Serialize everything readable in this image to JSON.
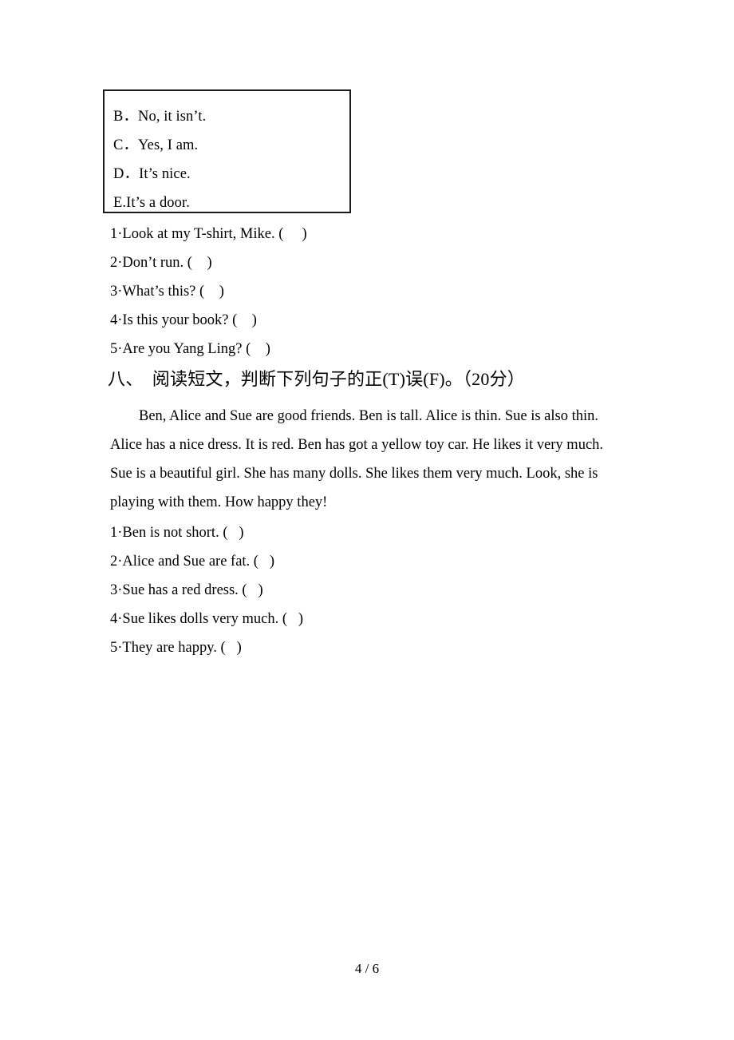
{
  "document": {
    "page_label": "4 / 6"
  },
  "options_box": {
    "options": [
      {
        "letter": "B．",
        "text": "No, it isn’t."
      },
      {
        "letter": "C．",
        "text": "Yes, I am."
      },
      {
        "letter": "D．",
        "text": "It’s nice."
      },
      {
        "letter": "E.",
        "text": "It’s a door."
      }
    ]
  },
  "matching_exercise": {
    "items": [
      {
        "number": "1",
        "separator": "·",
        "text": "Look at my T-shirt, Mike. (",
        "close": ")"
      },
      {
        "number": "2",
        "separator": "·",
        "text": "Don’t run. (",
        "close": ")"
      },
      {
        "number": "3",
        "separator": "·",
        "text": "What’s this? (",
        "close": ")"
      },
      {
        "number": "4",
        "separator": "·",
        "text": "Is this your book? (",
        "close": ")"
      },
      {
        "number": "5",
        "separator": "·",
        "text": "Are you Yang Ling? (",
        "close": ")"
      }
    ]
  },
  "section_eight": {
    "heading": "八、  阅读短文，判断下列句子的正(T)误(F)。（20分）",
    "passage_lines": [
      "Ben, Alice and Sue are good friends. Ben is tall. Alice is thin. Sue is also thin.",
      "Alice has a nice dress. It is red. Ben has got a yellow toy car. He likes it very much.",
      "Sue is a beautiful girl. She has many dolls. She likes them very much. Look, she is",
      "playing with them. How happy they!"
    ],
    "statements": [
      {
        "number": "1",
        "separator": "·",
        "text": "Ben is not short. (",
        "close": ")"
      },
      {
        "number": "2",
        "separator": "·",
        "text": "Alice and Sue are fat. (",
        "close": ")"
      },
      {
        "number": "3",
        "separator": "·",
        "text": "Sue has a red dress. (",
        "close": ")"
      },
      {
        "number": "4",
        "separator": "·",
        "text": "Sue likes dolls very much. (",
        "close": ")"
      },
      {
        "number": "5",
        "separator": "·",
        "text": "They are happy. (",
        "close": ")"
      }
    ]
  }
}
